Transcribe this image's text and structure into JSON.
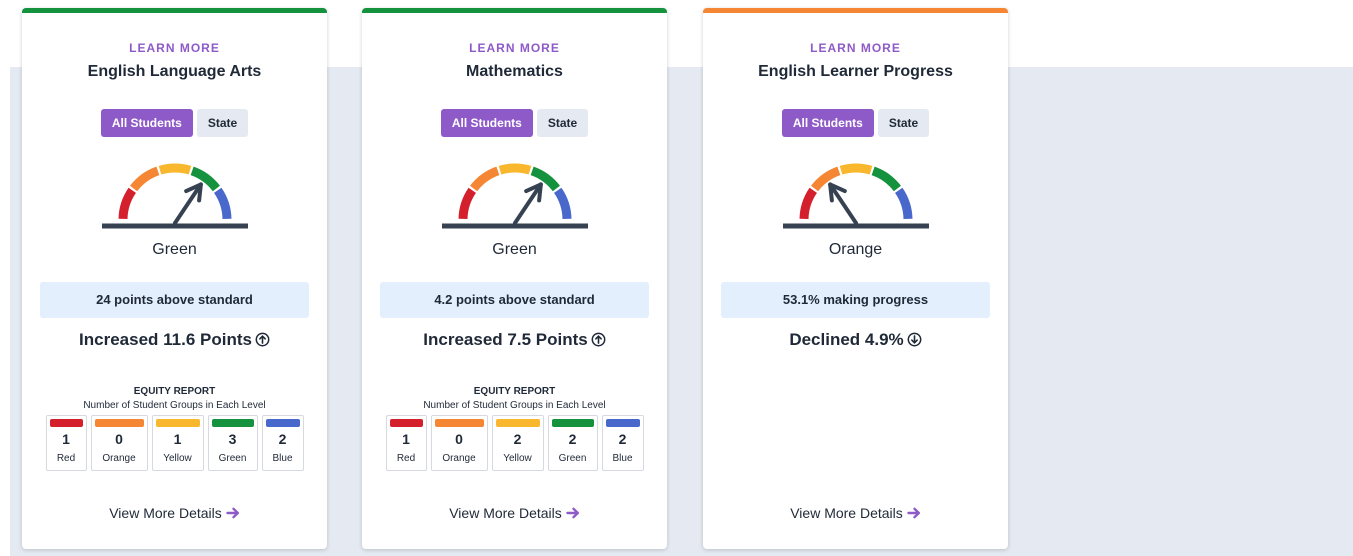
{
  "colors": {
    "red": "#d4202c",
    "orange": "#f58634",
    "yellow": "#f8b72c",
    "green": "#14923e",
    "blue": "#4968cc",
    "purple": "#8e5ac8",
    "needle": "#364152"
  },
  "cards": [
    {
      "learn_more": "LEARN MORE",
      "title": "English Language Arts",
      "toggle": {
        "all_students": "All Students",
        "state": "State"
      },
      "level": "Green",
      "gauge_level": 4,
      "status": "24 points above standard",
      "change": "Increased 11.6 Points",
      "change_direction": "up",
      "equity": {
        "title": "EQUITY REPORT",
        "subtitle": "Number of Student Groups in Each Level",
        "levels": [
          {
            "label": "Red",
            "count": "1",
            "color": "#d4202c"
          },
          {
            "label": "Orange",
            "count": "0",
            "color": "#f58634"
          },
          {
            "label": "Yellow",
            "count": "1",
            "color": "#f8b72c"
          },
          {
            "label": "Green",
            "count": "3",
            "color": "#14923e"
          },
          {
            "label": "Blue",
            "count": "2",
            "color": "#4968cc"
          }
        ]
      },
      "view_details": "View More Details"
    },
    {
      "learn_more": "LEARN MORE",
      "title": "Mathematics",
      "toggle": {
        "all_students": "All Students",
        "state": "State"
      },
      "level": "Green",
      "gauge_level": 4,
      "status": "4.2 points above standard",
      "change": "Increased 7.5 Points",
      "change_direction": "up",
      "equity": {
        "title": "EQUITY REPORT",
        "subtitle": "Number of Student Groups in Each Level",
        "levels": [
          {
            "label": "Red",
            "count": "1",
            "color": "#d4202c"
          },
          {
            "label": "Orange",
            "count": "0",
            "color": "#f58634"
          },
          {
            "label": "Yellow",
            "count": "2",
            "color": "#f8b72c"
          },
          {
            "label": "Green",
            "count": "2",
            "color": "#14923e"
          },
          {
            "label": "Blue",
            "count": "2",
            "color": "#4968cc"
          }
        ]
      },
      "view_details": "View More Details"
    },
    {
      "learn_more": "LEARN MORE",
      "title": "English Learner Progress",
      "toggle": {
        "all_students": "All Students",
        "state": "State"
      },
      "level": "Orange",
      "gauge_level": 2,
      "status": "53.1% making progress",
      "change": "Declined 4.9%",
      "change_direction": "down",
      "view_details": "View More Details"
    }
  ]
}
